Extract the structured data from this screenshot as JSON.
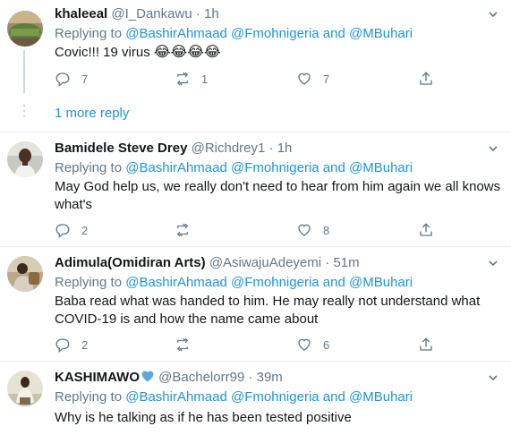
{
  "tweets": [
    {
      "name": "khaleeal",
      "handle": "@I_Dankawu",
      "dot": "·",
      "time": "1h",
      "replying_prefix": "Replying to",
      "mention1": "@BashirAhmaad",
      "mention2": "@Fmohnigeria",
      "and": "and",
      "mention3": "@MBuhari",
      "text": "Covic!!! 19 virus",
      "emojis": "😂😂😂😂",
      "replies": "7",
      "retweets": "1",
      "likes": "7"
    },
    {
      "name": "Bamidele Steve Drey",
      "handle": "@Richdrey1",
      "dot": "·",
      "time": "1h",
      "replying_prefix": "Replying to",
      "mention1": "@BashirAhmaad",
      "mention2": "@Fmohnigeria",
      "and": "and",
      "mention3": "@MBuhari",
      "text": "May God help us,  we really don't need to hear from him again we all knows what's",
      "replies": "2",
      "retweets": "",
      "likes": "8"
    },
    {
      "name": "Adimula(Omidiran Arts)",
      "handle": "@AsiwajuAdeyemi",
      "dot": "·",
      "time": "51m",
      "replying_prefix": "Replying to",
      "mention1": "@BashirAhmaad",
      "mention2": "@Fmohnigeria",
      "and": "and",
      "mention3": "@MBuhari",
      "text": "Baba read what was handed to him. He may really not understand what COVID-19 is and how the name came about",
      "replies": "2",
      "retweets": "",
      "likes": "6"
    },
    {
      "name": "KASHIMAWO",
      "handle": "@Bachelorr99",
      "dot": "·",
      "time": "39m",
      "replying_prefix": "Replying to",
      "mention1": "@BashirAhmaad",
      "mention2": "@Fmohnigeria",
      "and": "and",
      "mention3": "@MBuhari",
      "text": "Why is he talking as if he has been tested positive"
    }
  ],
  "more_reply": "1 more reply",
  "colors": {
    "link": "#1b95e0",
    "secondary": "#657786",
    "heart_badge": "#5da8e0"
  },
  "icons": [
    "reply-icon",
    "retweet-icon",
    "like-icon",
    "share-icon",
    "caret-down-icon"
  ]
}
